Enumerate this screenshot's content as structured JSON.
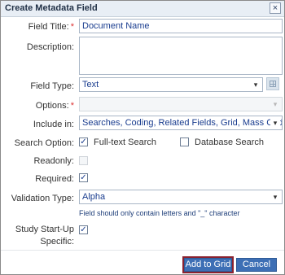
{
  "dialog": {
    "title": "Create Metadata Field",
    "close_glyph": "×"
  },
  "fields": {
    "field_title": {
      "label": "Field Title:",
      "required": "*",
      "value": "Document Name"
    },
    "description": {
      "label": "Description:",
      "value": ""
    },
    "field_type": {
      "label": "Field Type:",
      "value": "Text"
    },
    "options": {
      "label": "Options:",
      "required": "*",
      "value": ""
    },
    "include_in": {
      "label": "Include in:",
      "value": "Searches, Coding, Related Fields, Grid, Mass Coding"
    },
    "search_option": {
      "label": "Search Option:",
      "full_text": {
        "label": "Full-text Search",
        "checked": true
      },
      "database": {
        "label": "Database Search",
        "checked": false
      }
    },
    "readonly": {
      "label": "Readonly:",
      "checked": false
    },
    "required_field": {
      "label": "Required:",
      "checked": true
    },
    "validation_type": {
      "label": "Validation Type:",
      "value": "Alpha"
    },
    "validation_hint": "Field should only contain letters and \"_\" character",
    "study_startup": {
      "label_line1": "Study Start-Up",
      "label_line2": "Specific:",
      "checked": true
    }
  },
  "buttons": {
    "add_to_grid": "Add to Grid",
    "cancel": "Cancel"
  },
  "icons": {
    "dropdown": "chevron-down-icon",
    "grid": "grid-icon",
    "close": "close-icon",
    "check": "checkmark-icon"
  },
  "colors": {
    "primary_button": "#3d6fb5",
    "focus_outline": "#8a2230",
    "required": "#d33333"
  }
}
